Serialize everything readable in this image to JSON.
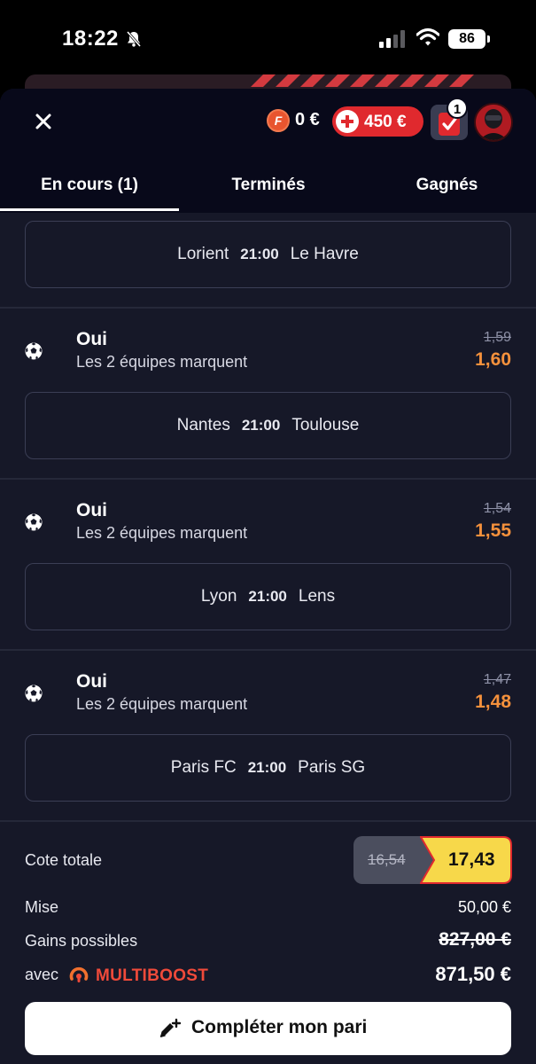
{
  "status_bar": {
    "time": "18:22",
    "battery": "86"
  },
  "header": {
    "freebet_coin": "F",
    "freebet_balance": "0 €",
    "bonus_amount": "450 €",
    "betslip_count": "1"
  },
  "tabs": [
    {
      "label": "En cours (1)",
      "active": true
    },
    {
      "label": "Terminés",
      "active": false
    },
    {
      "label": "Gagnés",
      "active": false
    }
  ],
  "selections": [
    {
      "home": "Lorient",
      "time": "21:00",
      "away": "Le Havre"
    },
    {
      "pick": "Oui",
      "market": "Les 2 équipes marquent",
      "old_odds": "1,59",
      "new_odds": "1,60",
      "home": "Nantes",
      "time": "21:00",
      "away": "Toulouse"
    },
    {
      "pick": "Oui",
      "market": "Les 2 équipes marquent",
      "old_odds": "1,54",
      "new_odds": "1,55",
      "home": "Lyon",
      "time": "21:00",
      "away": "Lens"
    },
    {
      "pick": "Oui",
      "market": "Les 2 équipes marquent",
      "old_odds": "1,47",
      "new_odds": "1,48",
      "home": "Paris FC",
      "time": "21:00",
      "away": "Paris SG"
    }
  ],
  "summary": {
    "total_odds_label": "Cote totale",
    "total_odds_old": "16,54",
    "total_odds_new": "17,43",
    "stake_label": "Mise",
    "stake_value": "50,00 €",
    "gains_label": "Gains possibles",
    "gains_old": "827,00 €",
    "with_label": "avec",
    "boost_brand": "MULTIBOOST",
    "gains_boosted": "871,50 €"
  },
  "cta": {
    "label": "Compléter mon pari"
  },
  "colors": {
    "background": "#161828",
    "header": "#08091a",
    "accent_red": "#e0292e",
    "odds_orange": "#f5913c",
    "boost_yellow": "#f7d84a"
  }
}
